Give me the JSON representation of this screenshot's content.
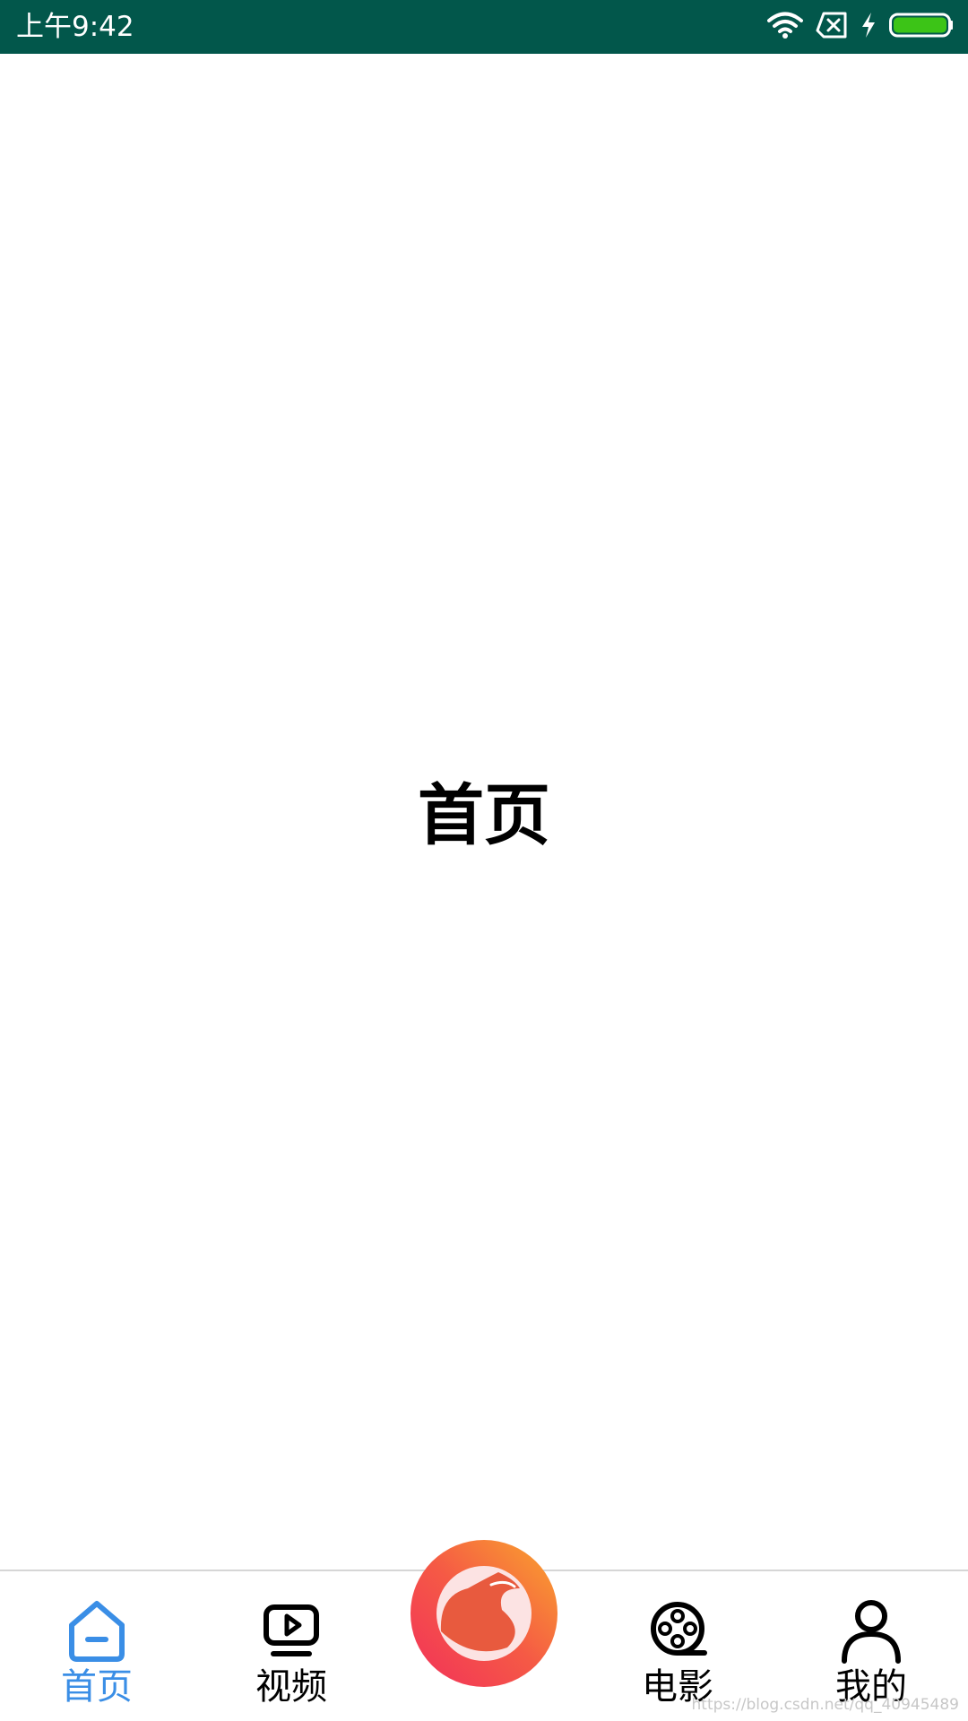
{
  "status_bar": {
    "time": "上午9:42",
    "icons": [
      "wifi-icon",
      "no-sim-icon",
      "charging-icon",
      "battery-icon"
    ],
    "background": "#02574B",
    "battery_color": "#3CC417"
  },
  "main": {
    "title": "首页"
  },
  "bottom_nav": {
    "items": [
      {
        "label": "首页",
        "icon": "home-icon",
        "active": true
      },
      {
        "label": "视频",
        "icon": "tv-play-icon",
        "active": false
      },
      {
        "label": "电影",
        "icon": "film-reel-icon",
        "active": false
      },
      {
        "label": "我的",
        "icon": "user-icon",
        "active": false
      }
    ],
    "center_button_icon": "bird-logo-icon",
    "active_color": "#3A8EE6"
  },
  "watermark": "https://blog.csdn.net/qq_40945489"
}
